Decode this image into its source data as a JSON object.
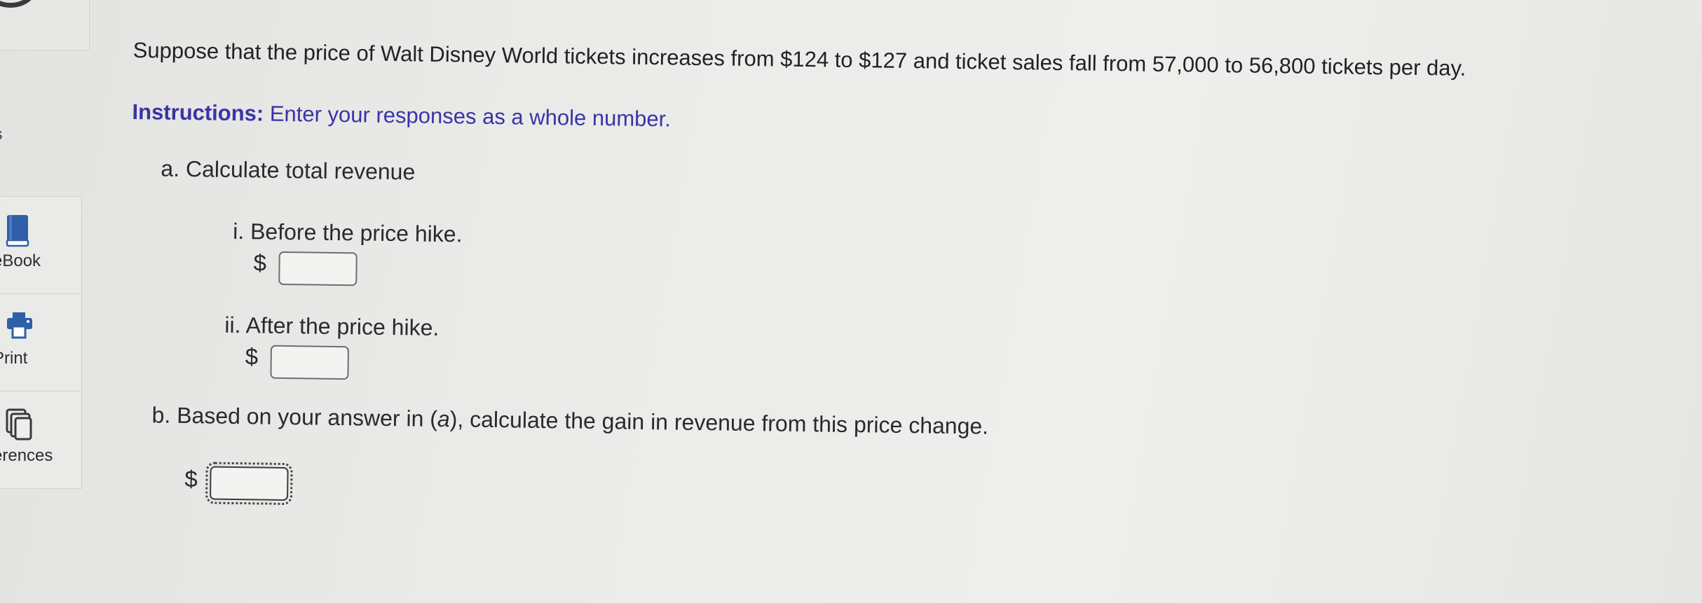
{
  "sidebar": {
    "cut_label": "s",
    "tools": [
      {
        "label": "eBook",
        "icon": "book-icon"
      },
      {
        "label": "Print",
        "icon": "printer-icon"
      },
      {
        "label": "erences",
        "icon": "references-icon"
      }
    ]
  },
  "question": {
    "intro": "Suppose that the price of Walt Disney World tickets increases from $124 to $127 and ticket sales fall from 57,000 to 56,800 tickets per day.",
    "instructions_bold": "Instructions:",
    "instructions_text": " Enter your responses as a whole number.",
    "part_a": {
      "label": "a. Calculate total revenue",
      "items": [
        {
          "label": "i. Before the price hike.",
          "currency": "$",
          "value": ""
        },
        {
          "label": "ii. After the price hike.",
          "currency": "$",
          "value": ""
        }
      ]
    },
    "part_b": {
      "label_prefix": "b. Based on your answer in (",
      "label_italic": "a",
      "label_suffix": "), calculate the gain in revenue from this price change.",
      "currency": "$",
      "value": ""
    }
  },
  "colors": {
    "instructions": "#3a33a8",
    "book_icon": "#2e5fa8",
    "print_icon": "#2e5fa8",
    "references_icon": "#3a3a3a"
  }
}
